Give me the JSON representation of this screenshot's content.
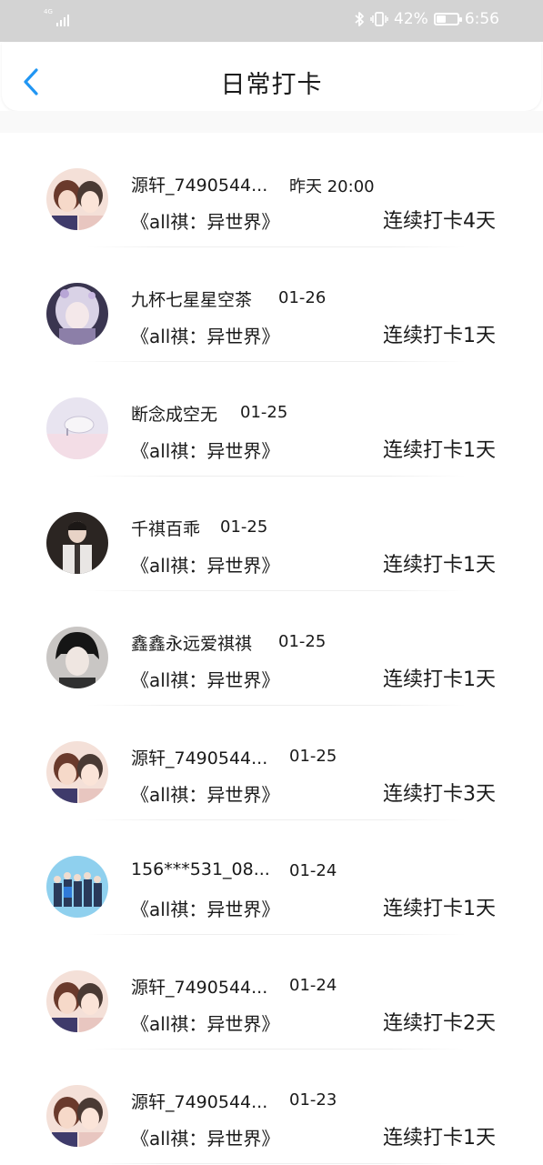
{
  "status_bar": {
    "network": "4G",
    "battery": "42%",
    "time": "6:56",
    "icons": [
      "signal-icon",
      "bluetooth-icon",
      "vibrate-icon",
      "battery-icon"
    ]
  },
  "header": {
    "title": "日常打卡",
    "back_icon": "chevron-left-icon",
    "accent_color": "#2196f3"
  },
  "checkins": [
    {
      "name": "源轩_7490544...",
      "time": "昨天 20:00",
      "book": "《all祺：异世界》",
      "streak": "连续打卡4天",
      "avatar": "avatar-pair-photo"
    },
    {
      "name": "九杯七星星空茶",
      "time": "01-26",
      "book": "《all祺：异世界》",
      "streak": "连续打卡1天",
      "avatar": "avatar-anime-girl"
    },
    {
      "name": "断念成空无",
      "time": "01-25",
      "book": "《all祺：异世界》",
      "streak": "连续打卡1天",
      "avatar": "avatar-pastel-scene"
    },
    {
      "name": "千祺百乖",
      "time": "01-25",
      "book": "《all祺：异世界》",
      "streak": "连续打卡1天",
      "avatar": "avatar-dark-photo"
    },
    {
      "name": "鑫鑫永远爱祺祺",
      "time": "01-25",
      "book": "《all祺：异世界》",
      "streak": "连续打卡1天",
      "avatar": "avatar-portrait"
    },
    {
      "name": "源轩_7490544...",
      "time": "01-25",
      "book": "《all祺：异世界》",
      "streak": "连续打卡3天",
      "avatar": "avatar-pair-photo"
    },
    {
      "name": "156***531_08...",
      "time": "01-24",
      "book": "《all祺：异世界》",
      "streak": "连续打卡1天",
      "avatar": "avatar-group-photo"
    },
    {
      "name": "源轩_7490544...",
      "time": "01-24",
      "book": "《all祺：异世界》",
      "streak": "连续打卡2天",
      "avatar": "avatar-pair-photo"
    },
    {
      "name": "源轩_7490544...",
      "time": "01-23",
      "book": "《all祺：异世界》",
      "streak": "连续打卡1天",
      "avatar": "avatar-pair-photo"
    }
  ]
}
